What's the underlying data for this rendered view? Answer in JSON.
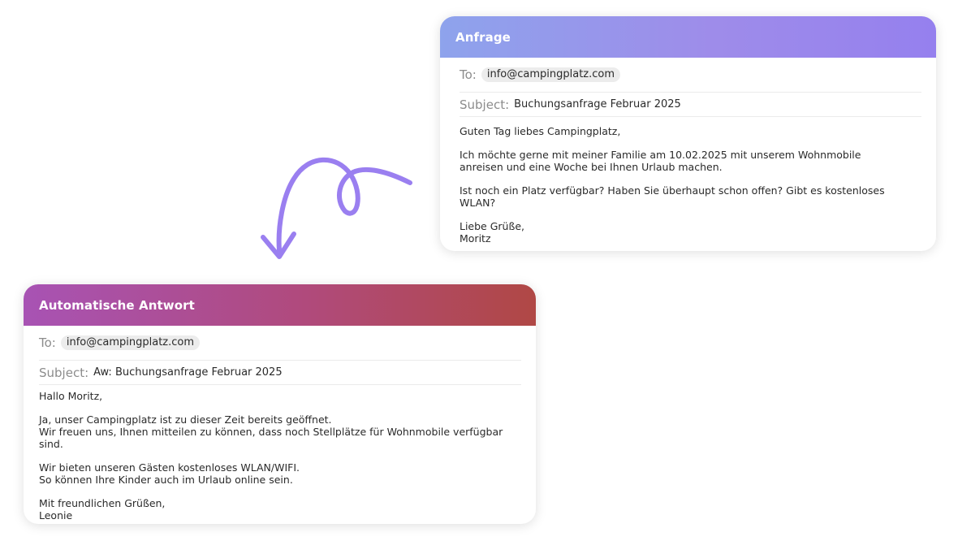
{
  "request": {
    "title": "Anfrage",
    "to_label": "To:",
    "to_value": "info@campingplatz.com",
    "subject_label": "Subject:",
    "subject_value": "Buchungsanfrage Februar 2025",
    "body": [
      "Guten Tag liebes Campingplatz,",
      "",
      "Ich möchte gerne mit meiner Familie am 10.02.2025 mit unserem Wohnmobile",
      "anreisen und eine Woche bei Ihnen Urlaub machen.",
      "",
      "Ist noch ein Platz verfügbar? Haben Sie überhaupt schon offen? Gibt es kostenloses WLAN?",
      "",
      "Liebe Grüße,",
      "Moritz"
    ]
  },
  "reply": {
    "title": "Automatische Antwort",
    "to_label": "To:",
    "to_value": "info@campingplatz.com",
    "subject_label": "Subject:",
    "subject_value": "Aw: Buchungsanfrage Februar 2025",
    "body": [
      "Hallo Moritz,",
      "",
      "Ja, unser Campingplatz ist zu dieser Zeit bereits geöffnet.",
      "Wir freuen uns, Ihnen mitteilen zu können, dass noch Stellplätze für Wohnmobile verfügbar sind.",
      "",
      "Wir bieten unseren Gästen kostenloses WLAN/WIFI.",
      "So können Ihre Kinder auch im Urlaub online sein.",
      "",
      "Mit freundlichen Grüßen,",
      "Leonie"
    ]
  },
  "colors": {
    "request_header_gradient": [
      "#8ea3ec",
      "#9580ee"
    ],
    "reply_header_gradient": [
      "#a853b4",
      "#b04845"
    ],
    "arrow": "#9a7ff0"
  },
  "icons": {
    "connector": "curved-arrow-icon"
  }
}
